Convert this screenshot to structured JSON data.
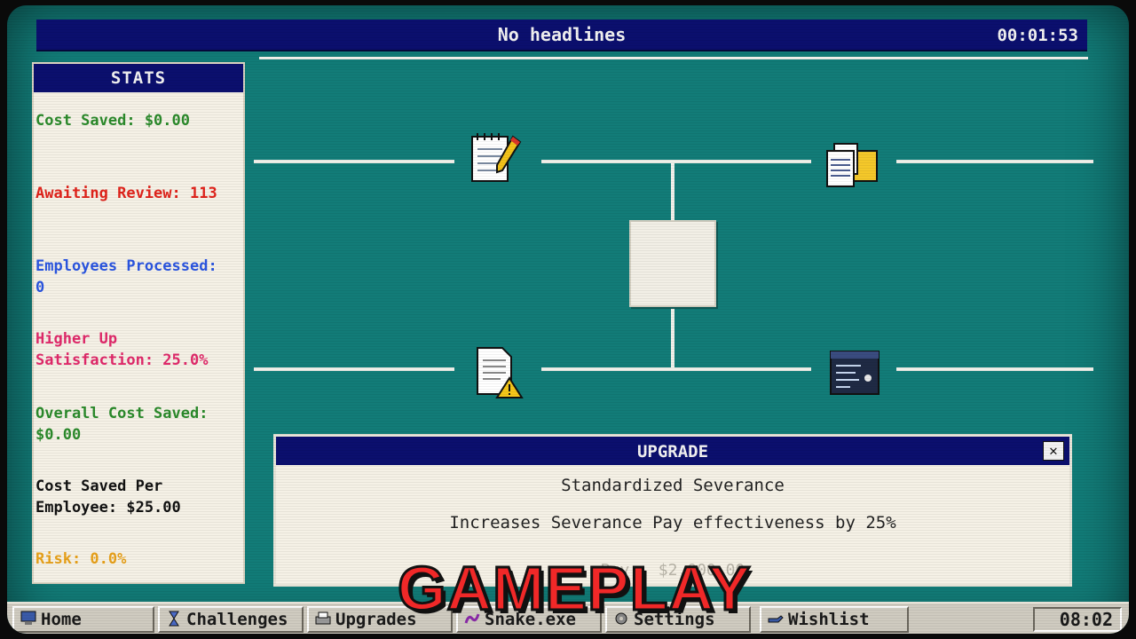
{
  "header": {
    "headline": "No headlines",
    "timer": "00:01:53"
  },
  "stats": {
    "title": "STATS",
    "cost_saved": "Cost Saved: $0.00",
    "awaiting_review": "Awaiting Review: 113",
    "employees_processed": "Employees Processed:\n0",
    "higher_up_satisfaction": "Higher Up\nSatisfaction: 25.0%",
    "overall_cost_saved": "Overall Cost Saved:\n$0.00",
    "cost_saved_per_employee": "Cost Saved Per\nEmployee: $25.00",
    "risk": "Risk: 0.0%"
  },
  "nodes": [
    {
      "icon": "notepad-pencil-icon"
    },
    {
      "icon": "documents-folder-icon"
    },
    {
      "icon": "document-warning-icon"
    },
    {
      "icon": "terminal-window-icon"
    }
  ],
  "upgrade_panel": {
    "title": "UPGRADE",
    "close_label": "✕",
    "name": "Standardized Severance",
    "description": "Increases Severance Pay effectiveness by 25%",
    "buy_label": "Buy - $2,000.00"
  },
  "taskbar": {
    "items": [
      {
        "label": "Home",
        "icon": "computer-icon"
      },
      {
        "label": "Challenges",
        "icon": "hourglass-icon"
      },
      {
        "label": "Upgrades",
        "icon": "printer-icon"
      },
      {
        "label": "Snake.exe",
        "icon": "snake-icon"
      },
      {
        "label": "Settings",
        "icon": "gear-icon"
      },
      {
        "label": "Wishlist",
        "icon": "hand-icon"
      }
    ],
    "clock": "08:02"
  },
  "overlay": {
    "text": "GAMEPLAY",
    "color": "#f02828"
  },
  "colors": {
    "desktop": "#127c78",
    "titlebar": "#0b0f6e",
    "panel": "#f5f1e6"
  }
}
